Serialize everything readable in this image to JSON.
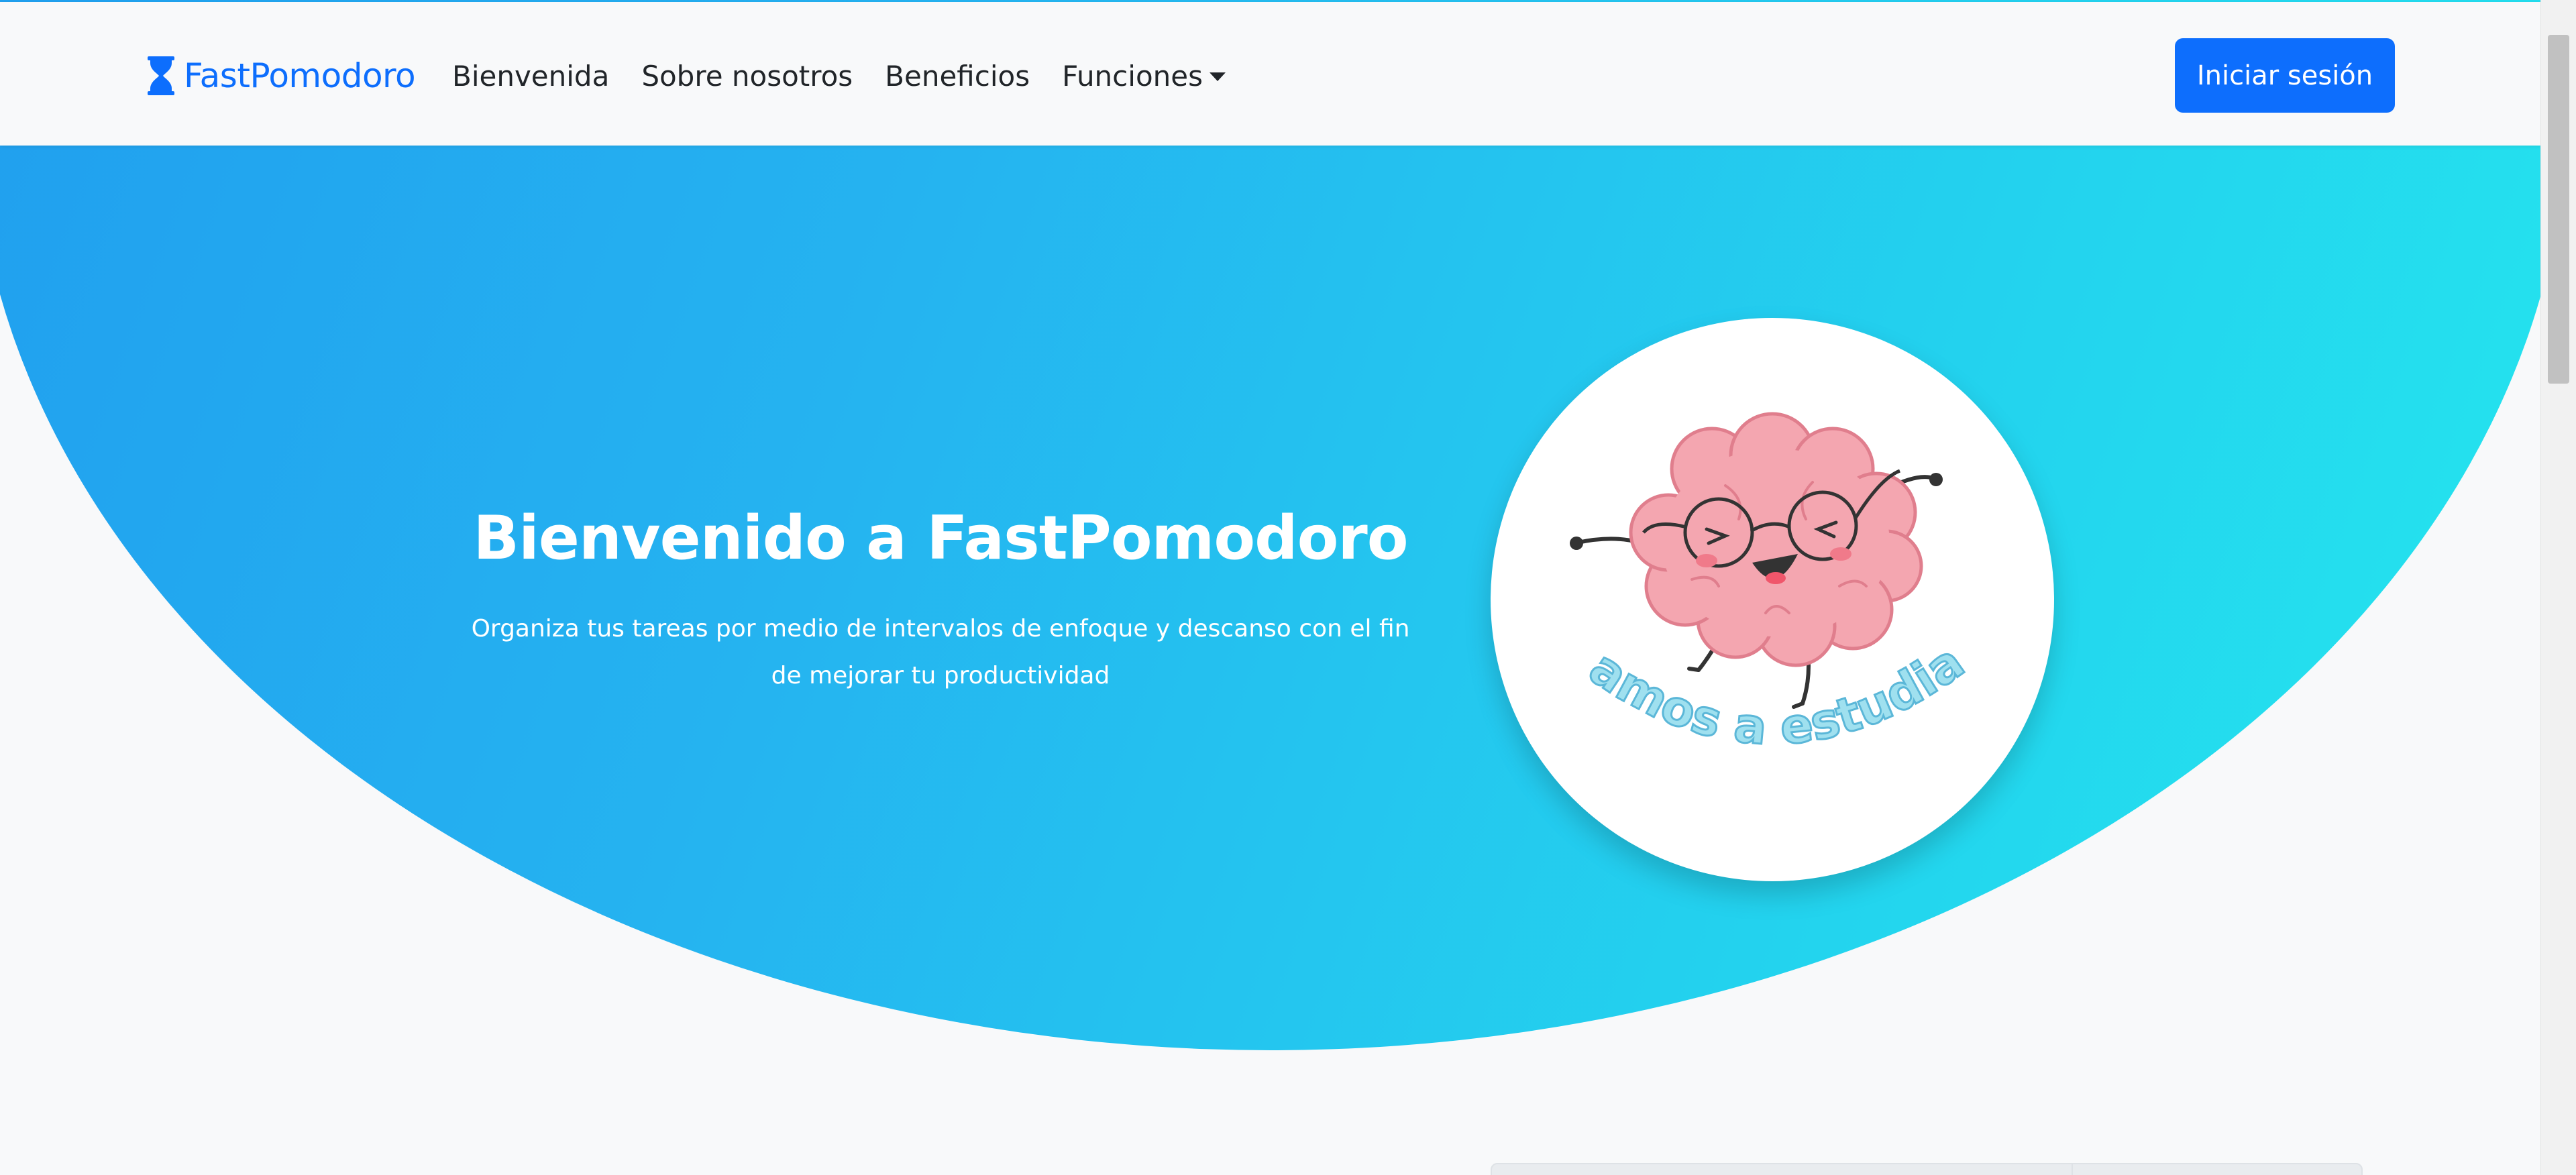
{
  "navbar": {
    "brand": "FastPomodoro",
    "links": [
      "Bienvenida",
      "Sobre nosotros",
      "Beneficios"
    ],
    "dropdown_label": "Funciones",
    "login_label": "Iniciar sesión"
  },
  "hero": {
    "title": "Bienvenido a FastPomodoro",
    "subtitle_line1": "Organiza tus tareas por medio de intervalos de enfoque y descanso con el fin",
    "subtitle_line2": "de mejorar tu productividad",
    "image_caption": "¡Vamos a estudiar!"
  },
  "colors": {
    "primary": "#0d6efd",
    "hero_gradient_start": "#1f99ee",
    "hero_gradient_end": "#24e8ee",
    "brain_pink": "#f4a6b0"
  },
  "icons": {
    "brand": "hourglass-icon",
    "dropdown": "caret-down-icon"
  }
}
